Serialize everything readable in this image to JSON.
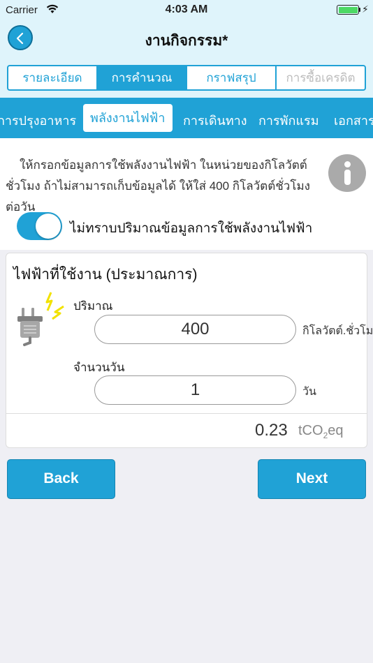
{
  "status": {
    "carrier": "Carrier",
    "time": "4:03 AM",
    "battery_level": 1.0
  },
  "nav": {
    "title": "งานกิจกรรม*"
  },
  "segments": [
    {
      "label": "รายละเอียด",
      "state": "normal"
    },
    {
      "label": "การคำนวณ",
      "state": "active"
    },
    {
      "label": "กราฟสรุป",
      "state": "normal"
    },
    {
      "label": "การซื้อเครดิต",
      "state": "disabled"
    }
  ],
  "categories": [
    {
      "label": "การปรุงอาหาร"
    },
    {
      "label": "พลังงานไฟฟ้า",
      "active": true
    },
    {
      "label": "การเดินทาง"
    },
    {
      "label": "การพักแรม"
    },
    {
      "label": "เอกสาร"
    }
  ],
  "info": {
    "text": "ให้กรอกข้อมูลการใช้พลังงานไฟฟ้า ในหน่วยของกิโลวัตต์ชั่วโมง ถ้าไม่สามารถเก็บข้อมูลได้ ให้ใส่ 400 กิโลวัตต์ชั่วโมงต่อวัน",
    "icon": "info-icon"
  },
  "toggle": {
    "label": "ไม่ทราบปริมาณข้อมูลการใช้พลังงานไฟฟ้า",
    "on": true
  },
  "card": {
    "title": "ไฟฟ้าที่ใช้งาน (ประมาณการ)",
    "icon": "electric-plug-icon",
    "quantity": {
      "label": "ปริมาณ",
      "value": "400",
      "unit": "กิโลวัตต์.ชั่วโมง"
    },
    "days": {
      "label": "จำนวนวัน",
      "value": "1",
      "unit": "วัน"
    },
    "result": {
      "value": "0.23",
      "unit_prefix": "tCO",
      "unit_sub": "2",
      "unit_suffix": "eq"
    }
  },
  "buttons": {
    "back": "Back",
    "next": "Next"
  },
  "colors": {
    "accent": "#20a2d6",
    "header_bg": "#dff4fb",
    "page_bg": "#efeff4",
    "toggle_on": "#20a2d6"
  }
}
